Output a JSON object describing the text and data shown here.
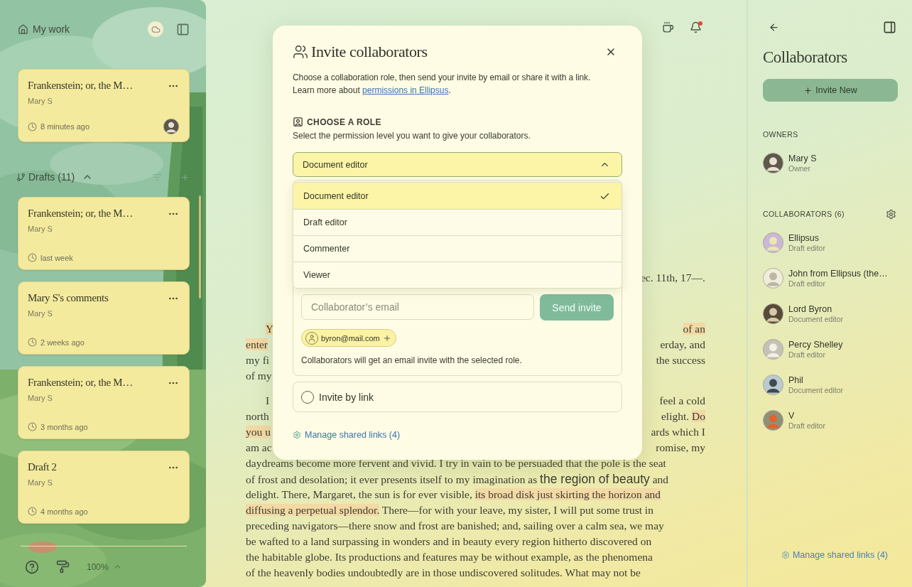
{
  "sidebar": {
    "title": "My work",
    "recent": {
      "title": "Frankenstein; or, the M…",
      "author": "Mary S",
      "time": "8 minutes ago",
      "has_avatar": true
    },
    "drafts": {
      "label": "Drafts (11)",
      "expanded": true,
      "cards": [
        {
          "title": "Frankenstein; or, the M…",
          "author": "Mary S",
          "time": "last week",
          "has_avatar": false
        },
        {
          "title": "Mary S's comments",
          "author": "Mary S",
          "time": "2 weeks ago",
          "has_avatar": false
        },
        {
          "title": "Frankenstein; or, the M…",
          "author": "Mary S",
          "time": "3 months ago",
          "has_avatar": false
        },
        {
          "title": "Draft 2",
          "author": "Mary S",
          "time": "4 months ago",
          "has_avatar": false
        }
      ]
    },
    "zoom": "100%"
  },
  "toolbar": {
    "bell_unread": true
  },
  "document": {
    "paragraphs": [
      {
        "lines": [
          {
            "right": [
              {
                "kind": "plain",
                "text": "ec. 11th, 17—."
              }
            ]
          }
        ]
      },
      {
        "lines": [
          {
            "left": [
              {
                "kind": "highlight",
                "text": "Y"
              }
            ],
            "right": [
              {
                "kind": "highlight",
                "text": "of an"
              }
            ]
          },
          {
            "left": [
              {
                "kind": "highlight",
                "text": "enter"
              }
            ],
            "right": [
              {
                "kind": "plain",
                "text": "erday, and"
              }
            ]
          },
          {
            "left": [
              {
                "kind": "plain",
                "text": "my fi"
              }
            ],
            "right": [
              {
                "kind": "plain",
                "text": "the success"
              }
            ]
          },
          {
            "left": [
              {
                "kind": "plain",
                "text": "of my"
              }
            ]
          }
        ]
      },
      {
        "lines": [
          {
            "left": [
              {
                "kind": "plain",
                "text": "I"
              }
            ],
            "right": [
              {
                "kind": "plain",
                "text": "feel a cold"
              }
            ]
          },
          {
            "left": [
              {
                "kind": "plain",
                "text": "north"
              }
            ],
            "right": [
              {
                "kind": "plain",
                "text": "elight. "
              },
              {
                "kind": "highlight",
                "text": "Do"
              }
            ]
          },
          {
            "left": [
              {
                "kind": "highlight",
                "text": "you u"
              }
            ],
            "right": [
              {
                "kind": "plain",
                "text": "ards which I"
              }
            ]
          },
          {
            "left": [
              {
                "kind": "plain",
                "text": "am ac"
              }
            ],
            "right": [
              {
                "kind": "plain",
                "text": "romise, my"
              }
            ]
          },
          {
            "full": [
              {
                "kind": "plain",
                "text": "daydreams become more fervent and vivid. I try in vain to be persuaded that the pole is the seat"
              }
            ]
          },
          {
            "full": [
              {
                "kind": "plain",
                "text": "of frost and desolation; it ever presents itself to my imagination as "
              },
              {
                "kind": "large",
                "text": "the region of beauty"
              },
              {
                "kind": "plain",
                "text": " and"
              }
            ]
          },
          {
            "full": [
              {
                "kind": "plain",
                "text": "delight. There, Margaret, the sun is for ever visible, "
              },
              {
                "kind": "highlight",
                "text": "its broad disk just skirting the horizon and"
              }
            ]
          },
          {
            "full": [
              {
                "kind": "highlight",
                "text": "diffusing a perpetual splendor."
              },
              {
                "kind": "plain",
                "text": " There—for with your leave, my sister, I will put some trust in"
              }
            ]
          },
          {
            "full": [
              {
                "kind": "plain",
                "text": "preceding navigators—there snow and frost are banished; and, sailing over a calm sea, we may"
              }
            ]
          },
          {
            "full": [
              {
                "kind": "plain",
                "text": "be wafted to a land surpassing in wonders and in beauty every region hitherto discovered on"
              }
            ]
          },
          {
            "full": [
              {
                "kind": "plain",
                "text": "the habitable globe. Its productions and features may be without example, as the phenomena"
              }
            ]
          },
          {
            "full": [
              {
                "kind": "plain",
                "text": "of the heavenly bodies undoubtedly are in those undiscovered solitudes. What may not be"
              }
            ]
          }
        ]
      }
    ]
  },
  "dialog": {
    "title": "Invite collaborators",
    "description": "Choose a collaboration role, then send your invite by email or share it with a link.",
    "learn_more": {
      "text": "Learn more about ",
      "link": "permissions in Ellipsus",
      "after": "."
    },
    "role_heading": "CHOOSE A ROLE",
    "role_hint": "Select the permission level you want to give your collaborators.",
    "select": {
      "value": "Document editor",
      "expanded": true
    },
    "options": [
      {
        "label": "Document editor",
        "selected": true
      },
      {
        "label": "Draft editor",
        "selected": false
      },
      {
        "label": "Commenter",
        "selected": false
      },
      {
        "label": "Viewer",
        "selected": false
      }
    ],
    "email": {
      "placeholder": "Collaborator’s email",
      "send": "Send invite",
      "send_disabled": true,
      "chips": [
        "byron@mail.com"
      ],
      "note": "Collaborators will get an email invite with the selected role."
    },
    "link_option": {
      "label": "Invite by link",
      "selected": false
    },
    "manage_link": "Manage shared links (4)"
  },
  "panel": {
    "title": "Collaborators",
    "invite": "Invite New",
    "owners_heading": "OWNERS",
    "owners": [
      {
        "name": "Mary S",
        "role": "Owner"
      }
    ],
    "collaborators_heading": "COLLABORATORS (6)",
    "collaborators": [
      {
        "name": "Ellipsus",
        "role": "Draft editor"
      },
      {
        "name": "John from Ellipsus (the…",
        "role": "Draft editor"
      },
      {
        "name": "Lord Byron",
        "role": "Document editor"
      },
      {
        "name": "Percy Shelley",
        "role": "Draft editor"
      },
      {
        "name": "Phil",
        "role": "Document editor"
      },
      {
        "name": "V",
        "role": "Draft editor"
      }
    ],
    "manage_link": "Manage shared links (4)"
  }
}
